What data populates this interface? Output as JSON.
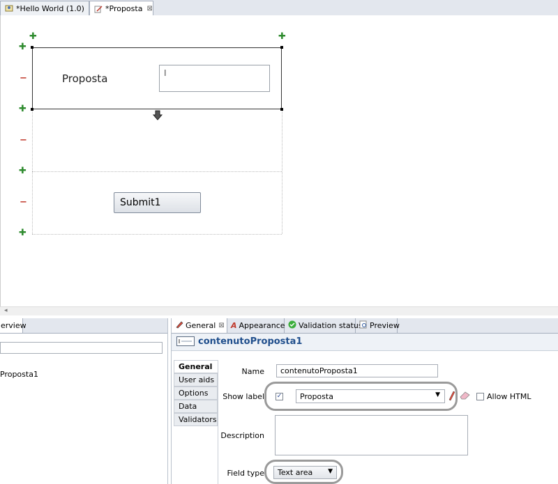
{
  "editor_tabs": [
    {
      "label": "*Hello World (1.0)"
    },
    {
      "label": "*Proposta"
    }
  ],
  "canvas": {
    "field_label": "Proposta",
    "submit_label": "Submit1"
  },
  "left_pane": {
    "tab_label": "erview",
    "tree_item": "Proposta1"
  },
  "properties": {
    "tabs": [
      "General",
      "Appearance",
      "Validation status",
      "Preview"
    ],
    "header_title": "contenutoProposta1",
    "side_tabs": [
      "General",
      "User aids",
      "Options",
      "Data",
      "Validators"
    ],
    "name_label": "Name",
    "name_value": "contenutoProposta1",
    "show_label_label": "Show label",
    "show_label_checked": true,
    "show_label_value": "Proposta",
    "allow_html_label": "Allow HTML",
    "description_label": "Description",
    "description_value": "",
    "field_type_label": "Field type",
    "field_type_value": "Text area"
  },
  "colors": {
    "accent_title": "#1f4e8c",
    "plus": "#2e8b2e",
    "minus": "#c0392b"
  }
}
